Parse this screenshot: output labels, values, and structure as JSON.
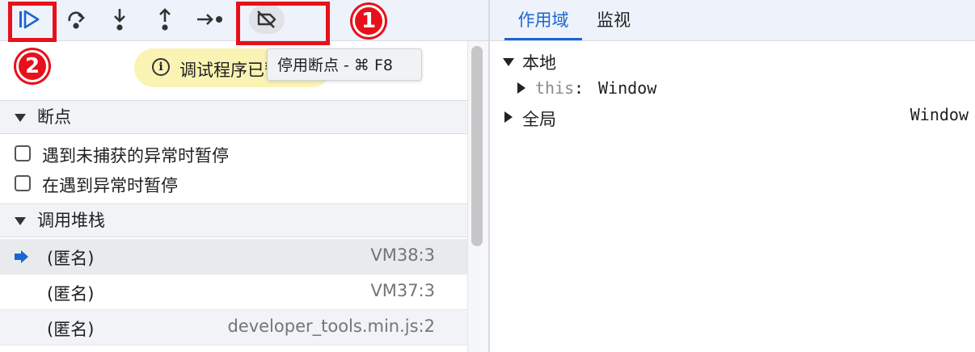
{
  "toolbar": {
    "buttons": [
      {
        "id": "resume",
        "icon": "resume-icon"
      },
      {
        "id": "step-over",
        "icon": "step-over-icon"
      },
      {
        "id": "step-into",
        "icon": "step-into-icon"
      },
      {
        "id": "step-out",
        "icon": "step-out-icon"
      },
      {
        "id": "step",
        "icon": "step-icon"
      },
      {
        "id": "deactivate-breakpoints",
        "icon": "deactivate-breakpoints-icon"
      }
    ],
    "annotation_1": "1",
    "annotation_2": "2",
    "tooltip": "停用断点 - ⌘ F8"
  },
  "pause_banner": {
    "text": "调试程序已暂停",
    "icon": "info-icon"
  },
  "breakpoints": {
    "title": "断点",
    "options": [
      {
        "label": "遇到未捕获的异常时暂停",
        "checked": false
      },
      {
        "label": "在遇到异常时暂停",
        "checked": false
      }
    ]
  },
  "call_stack": {
    "title": "调用堆栈",
    "frames": [
      {
        "name": "(匿名)",
        "location": "VM38:3",
        "current": true
      },
      {
        "name": "(匿名)",
        "location": "VM37:3",
        "current": false
      },
      {
        "name": "(匿名)",
        "location": "developer_tools.min.js:2",
        "current": false
      }
    ]
  },
  "right_panel": {
    "tabs": [
      "作用域",
      "监视"
    ],
    "active_tab": "作用域",
    "scope": {
      "local_label": "本地",
      "this_key": "this",
      "this_sep": ":",
      "this_value": "Window",
      "global_label": "全局",
      "global_value": "Window"
    }
  },
  "colors": {
    "accent": "#1a66d2",
    "annotation_red": "#e8101a",
    "banner_yellow": "#fbf3b3"
  }
}
